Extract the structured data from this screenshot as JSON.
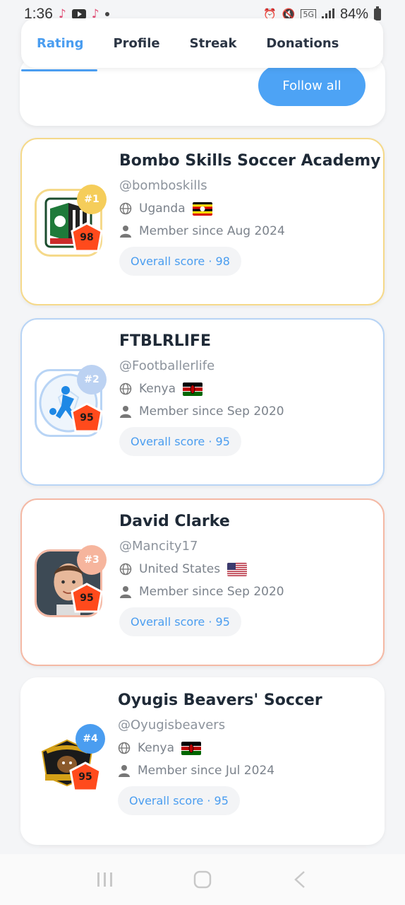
{
  "status_bar": {
    "time": "1:36",
    "battery": "84%",
    "network": "5G"
  },
  "tabs": [
    {
      "label": "Rating",
      "active": true
    },
    {
      "label": "Profile",
      "active": false
    },
    {
      "label": "Streak",
      "active": false
    },
    {
      "label": "Donations",
      "active": false
    }
  ],
  "follow_all_label": "Follow all",
  "accent_color": "#4a9df0",
  "users": [
    {
      "rank": "#1",
      "name": "Bombo Skills Soccer Academy",
      "handle": "@bomboskills",
      "country": "Uganda",
      "member_since": "Member since Aug 2024",
      "overall_score": "Overall score · 98",
      "score": "98",
      "border_color": "#f5d98a",
      "rank_color": "#f5cd5a"
    },
    {
      "rank": "#2",
      "name": "FTBLRLIFE",
      "handle": "@Footballerlife",
      "country": "Kenya",
      "member_since": "Member since Sep 2020",
      "overall_score": "Overall score · 95",
      "score": "95",
      "border_color": "#b8d4f5",
      "rank_color": "#bcd2f2"
    },
    {
      "rank": "#3",
      "name": "David Clarke",
      "handle": "@Mancity17",
      "country": "United States",
      "member_since": "Member since Sep 2020",
      "overall_score": "Overall score · 95",
      "score": "95",
      "border_color": "#f4b9a5",
      "rank_color": "#f6b59d"
    },
    {
      "rank": "#4",
      "name": "Oyugis Beavers' Soccer",
      "handle": "@Oyugisbeavers",
      "country": "Kenya",
      "member_since": "Member since Jul 2024",
      "overall_score": "Overall score · 95",
      "score": "95",
      "border_color": "#ffffff",
      "rank_color": "#4a9df0"
    }
  ]
}
